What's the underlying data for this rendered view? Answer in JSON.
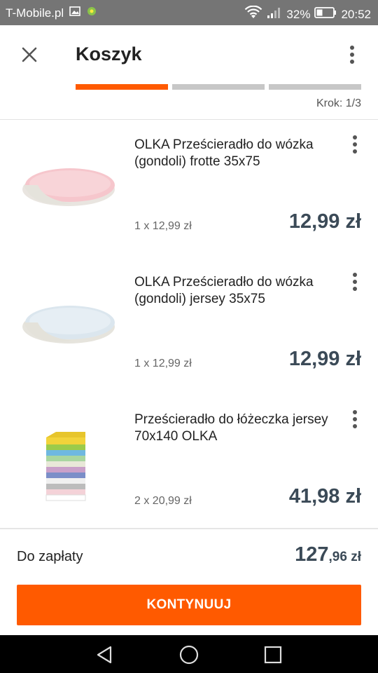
{
  "status_bar": {
    "carrier": "T-Mobile.pl",
    "battery": "32%",
    "time": "20:52"
  },
  "header": {
    "title": "Koszyk",
    "step_text": "Krok: 1/3",
    "steps_total": 3,
    "step_current": 1
  },
  "items": [
    {
      "name": "OLKA Prześcieradło do wózka (gondoli) frotte 35x75",
      "qty_text": "1 x 12,99 zł",
      "price": "12,99 zł",
      "image": "pink-oval-sheet"
    },
    {
      "name": "OLKA Prześcieradło do wózka (gondoli) jersey 35x75",
      "qty_text": "1 x 12,99 zł",
      "price": "12,99 zł",
      "image": "blue-oval-sheet"
    },
    {
      "name": "Prześcieradło do łóżeczka jersey 70x140 OLKA",
      "qty_text": "2 x 20,99 zł",
      "price": "41,98 zł",
      "image": "stacked-colored-sheets"
    }
  ],
  "summary": {
    "label": "Do zapłaty",
    "total_int": "127",
    "total_dec": ",96 zł"
  },
  "cta": {
    "label": "KONTYNUUJ"
  },
  "colors": {
    "accent": "#ff5a00",
    "price_text": "#3b4a57",
    "status_bar": "#757575"
  }
}
